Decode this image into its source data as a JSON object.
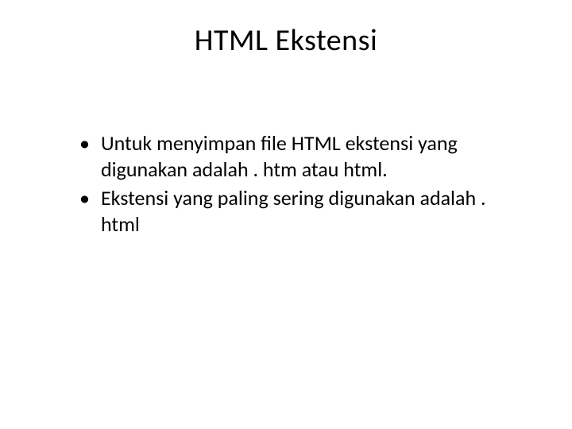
{
  "slide": {
    "title": "HTML Ekstensi",
    "bullets": [
      "Untuk menyimpan file HTML ekstensi yang digunakan adalah . htm atau html.",
      "Ekstensi yang paling sering digunakan adalah . html"
    ]
  }
}
